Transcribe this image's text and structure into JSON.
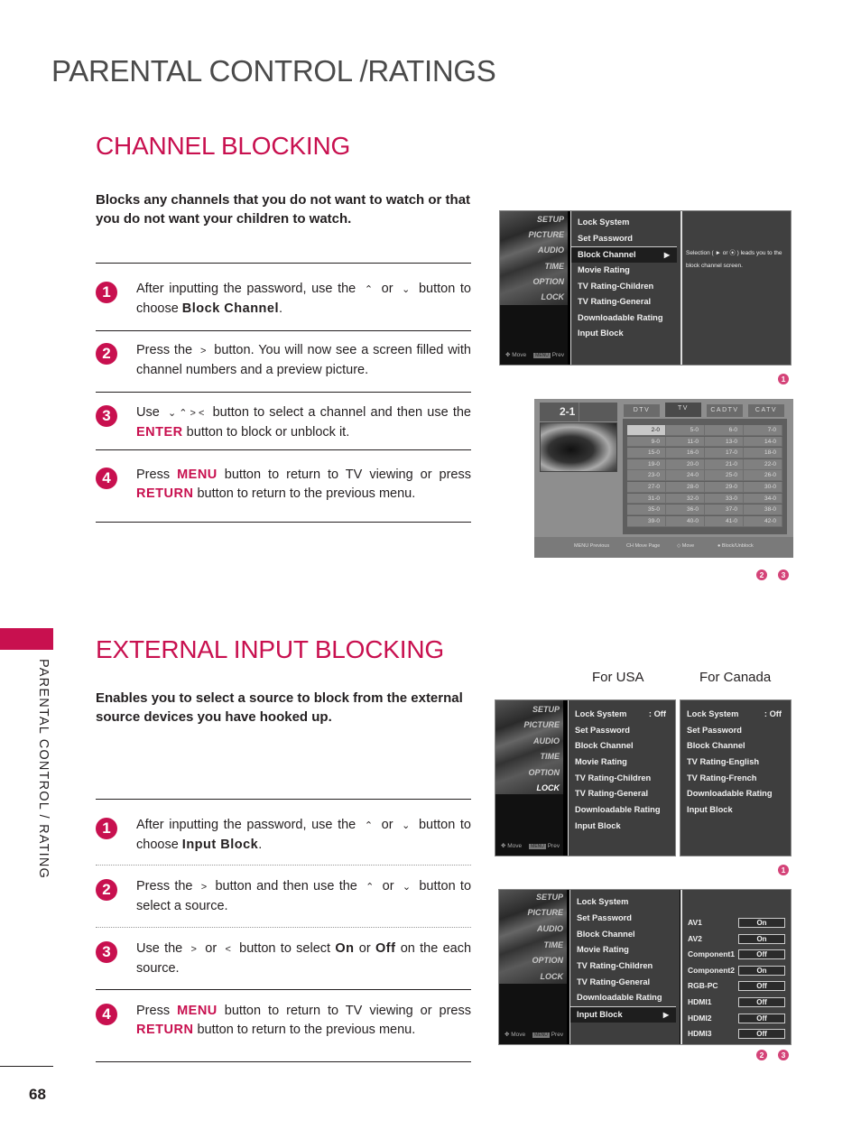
{
  "page": {
    "title": "PARENTAL CONTROL /RATINGS",
    "sidebar_label": "PARENTAL CONTROL / RATING",
    "page_number": "68",
    "accent_color": "#c8104f"
  },
  "channel_blocking": {
    "title": "CHANNEL BLOCKING",
    "intro": "Blocks any channels that you do not want to watch or that you do not want your children to watch.",
    "steps": [
      {
        "num": "1",
        "parts": [
          "After inputting the password, use the ",
          "^",
          " or ",
          "v",
          " button to choose ",
          "Block Channel",
          "."
        ]
      },
      {
        "num": "2",
        "parts": [
          "Press the ",
          ">",
          " button. You will now see a screen filled with channel numbers and a preview picture."
        ]
      },
      {
        "num": "3",
        "parts": [
          "Use ",
          "v ^ > <",
          " button to select a channel and then use the ",
          "ENTER",
          " button to block or unblock it."
        ]
      },
      {
        "num": "4",
        "parts": [
          "Press ",
          "MENU",
          " button to return to TV viewing or press ",
          "RETURN",
          " button to return to the previous menu."
        ]
      }
    ],
    "osd": {
      "categories": [
        "SETUP",
        "PICTURE",
        "AUDIO",
        "TIME",
        "OPTION",
        "LOCK"
      ],
      "hint_move": "Move",
      "hint_menu": "MENU",
      "hint_prev": "Prev",
      "items": [
        "Lock System",
        "Set Password",
        "Block Channel",
        "Movie Rating",
        "TV Rating-Children",
        "TV Rating-General",
        "Downloadable Rating",
        "Input Block"
      ],
      "selected_item": "Block Channel",
      "description_line1": "Selection ( ► or ⦿ ) leads you to the",
      "description_line2": "block channel screen.",
      "ref": "1"
    },
    "channel_screen": {
      "current_channel": "2-1",
      "tabs": [
        "DTV",
        "TV",
        "CADTV",
        "CATV"
      ],
      "active_tab": "TV",
      "channels": [
        [
          "2-0",
          "5-0",
          "6-0",
          "7-0"
        ],
        [
          "9-0",
          "11-0",
          "13-0",
          "14-0"
        ],
        [
          "15-0",
          "16-0",
          "17-0",
          "18-0"
        ],
        [
          "19-0",
          "20-0",
          "21-0",
          "22-0"
        ],
        [
          "23-0",
          "24-0",
          "25-0",
          "26-0"
        ],
        [
          "27-0",
          "28-0",
          "29-0",
          "30-0"
        ],
        [
          "31-0",
          "32-0",
          "33-0",
          "34-0"
        ],
        [
          "35-0",
          "36-0",
          "37-0",
          "38-0"
        ],
        [
          "39-0",
          "40-0",
          "41-0",
          "42-0"
        ]
      ],
      "selected_channel": "2-0",
      "footer": {
        "previous": "MENU Previous",
        "move_page": "CH Move Page",
        "move": "◇ Move",
        "block": "● Block/Unblock"
      },
      "refs": [
        "2",
        "3"
      ]
    }
  },
  "external_input_blocking": {
    "title": "EXTERNAL INPUT BLOCKING",
    "intro": "Enables you to select a source to block from the external source devices you have hooked up.",
    "col_usa": "For USA",
    "col_canada": "For Canada",
    "steps": [
      {
        "num": "1",
        "parts": [
          "After inputting the password, use the ",
          "^",
          " or ",
          "v",
          " button to choose ",
          "Input Block",
          "."
        ]
      },
      {
        "num": "2",
        "parts": [
          "Press the ",
          ">",
          " button and then use the ",
          "^",
          " or ",
          "v",
          " button to select a source."
        ]
      },
      {
        "num": "3",
        "parts": [
          "Use the ",
          ">",
          " or ",
          "<",
          " button to select ",
          "On",
          " or ",
          "Off",
          " on the each source."
        ]
      },
      {
        "num": "4",
        "parts": [
          "Press ",
          "MENU",
          " button to return to TV viewing or press ",
          "RETURN",
          " button to return to the previous menu."
        ]
      }
    ],
    "osd_usa": {
      "items": [
        "Lock System",
        "Set Password",
        "Block Channel",
        "Movie Rating",
        "TV Rating-Children",
        "TV Rating-General",
        "Downloadable Rating",
        "Input Block"
      ],
      "lock_value": ": Off"
    },
    "osd_canada": {
      "items": [
        "Lock System",
        "Set Password",
        "Block Channel",
        "TV Rating-English",
        "TV Rating-French",
        "Downloadable Rating",
        "Input Block"
      ],
      "lock_value": ": Off"
    },
    "ref_top": "1",
    "osd_input": {
      "items": [
        "Lock System",
        "Set Password",
        "Block Channel",
        "Movie Rating",
        "TV Rating-Children",
        "TV Rating-General",
        "Downloadable Rating",
        "Input Block"
      ],
      "selected_item": "Input Block",
      "sources": [
        {
          "name": "AV1",
          "value": "On"
        },
        {
          "name": "AV2",
          "value": "On"
        },
        {
          "name": "Component1",
          "value": "Off"
        },
        {
          "name": "Component2",
          "value": "On"
        },
        {
          "name": "RGB-PC",
          "value": "Off"
        },
        {
          "name": "HDMI1",
          "value": "Off"
        },
        {
          "name": "HDMI2",
          "value": "Off"
        },
        {
          "name": "HDMI3",
          "value": "Off"
        }
      ],
      "refs": [
        "2",
        "3"
      ]
    }
  }
}
